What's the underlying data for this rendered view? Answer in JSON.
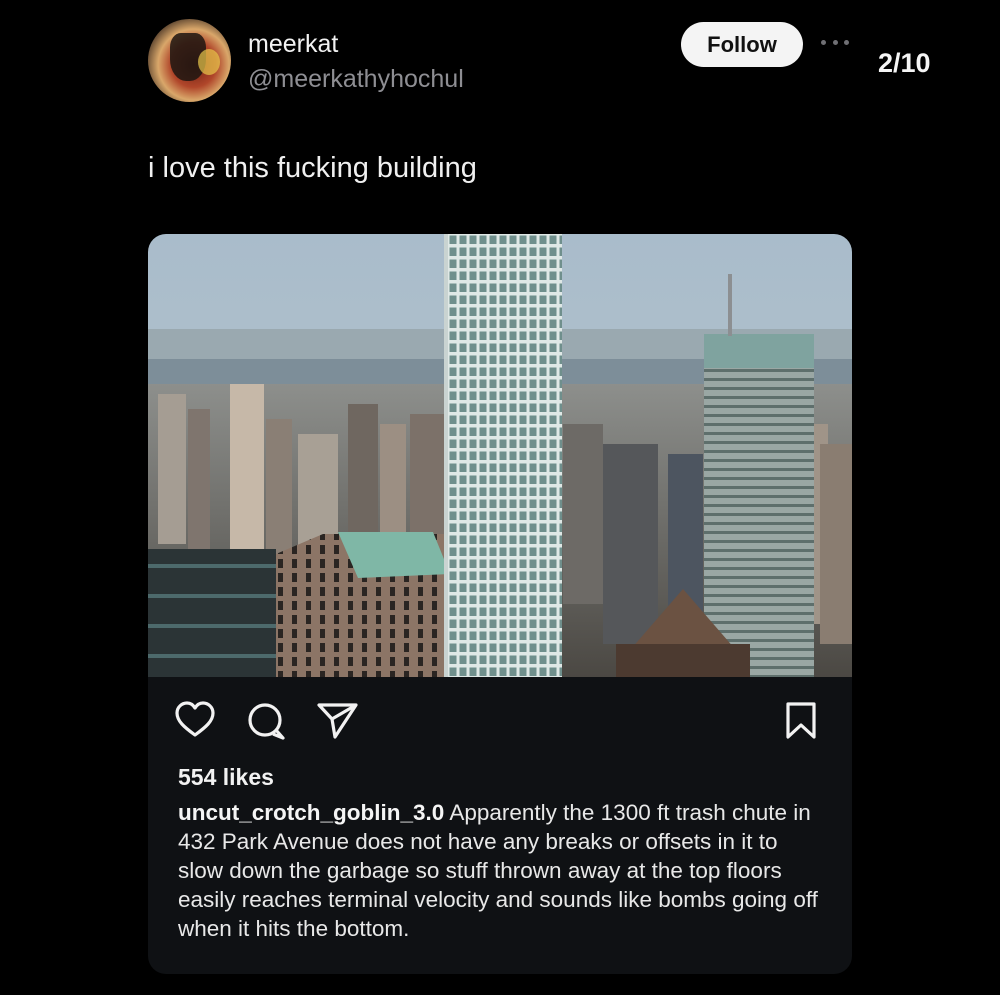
{
  "author": {
    "display_name": "meerkat",
    "handle": "@meerkathyhochul"
  },
  "header": {
    "follow_label": "Follow",
    "page_counter": "2/10"
  },
  "post": {
    "text": "i love this fucking building"
  },
  "embed": {
    "likes": "554 likes",
    "caption_user": "uncut_crotch_goblin_3.0",
    "caption_text": " Apparently the 1300 ft trash chute in 432 Park Avenue does not have any breaks or offsets in it to slow down the garbage so stuff thrown away at the top floors easily reaches terminal velocity and sounds like bombs going off when it hits the bottom."
  },
  "icons": {
    "like": "heart-icon",
    "comment": "comment-bubble-icon",
    "share": "send-icon",
    "save": "bookmark-icon",
    "more": "more-dots-icon"
  },
  "colors": {
    "background": "#000000",
    "card": "#0f1114",
    "follow_button": "#f4f4f4",
    "handle": "#8e8e93"
  }
}
